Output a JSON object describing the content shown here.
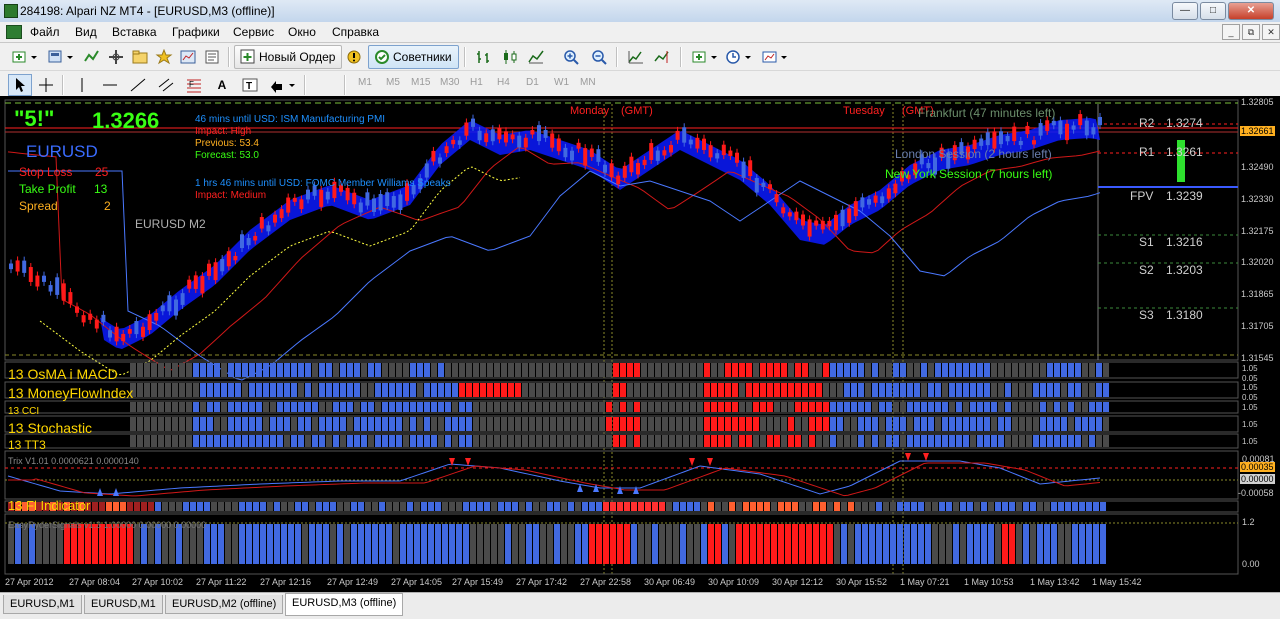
{
  "window": {
    "title": "284198: Alpari NZ MT4 - [EURUSD,M3 (offline)]"
  },
  "menu": [
    "Файл",
    "Вид",
    "Вставка",
    "Графики",
    "Сервис",
    "Окно",
    "Справка"
  ],
  "toolbar": {
    "new_order": "Новый Ордер",
    "experts": "Советники",
    "timeframes": [
      "M1",
      "M5",
      "M15",
      "M30",
      "H1",
      "H4",
      "D1",
      "W1",
      "MN"
    ]
  },
  "chart": {
    "big_left": "\"5!\"",
    "big_price": "1.3266",
    "symbol": "EURUSD",
    "symbol_period": "EURUSD M2",
    "stats": [
      {
        "label": "Stop Loss",
        "value": "25"
      },
      {
        "label": "Take Profit",
        "value": "13"
      },
      {
        "label": "Spread",
        "value": "2"
      }
    ],
    "news1": {
      "title": "46 mins until USD: ISM Manufacturing PMI",
      "impact": "Impact: High",
      "previous": "Previous: 53.4",
      "forecast": "Forecast: 53.0"
    },
    "news2": {
      "title": "1 hrs 46 mins until USD: FOMC Member Williams Speaks",
      "impact": "Impact: Medium"
    },
    "sessions": {
      "monday": "Monday",
      "gmt1": "(GMT)",
      "tuesday": "Tuesday",
      "gmt2": "(GMT)",
      "frankfurt": "Frankfurt (47 minutes left)",
      "london": "London Session (2 hours left)",
      "newyork": "New York Session (7 hours left)"
    },
    "pivots": [
      {
        "label": "R2",
        "value": "1.3274"
      },
      {
        "label": "R1",
        "value": "1.3261"
      },
      {
        "label": "FPV",
        "value": "1.3239"
      },
      {
        "label": "S1",
        "value": "1.3216"
      },
      {
        "label": "S2",
        "value": "1.3203"
      },
      {
        "label": "S3",
        "value": "1.3180"
      }
    ],
    "price_scale": [
      "1.32805",
      "1.32661",
      "1.32490",
      "1.32330",
      "1.32175",
      "1.32020",
      "1.31865",
      "1.31705",
      "1.31545"
    ],
    "current_price_tag": "1.32661",
    "indicator_labels": [
      "13 OsMA i MACD",
      "13 MoneyFlowIndex",
      "13 CCI",
      "13 Stochastic",
      "13 TT3"
    ],
    "indicator_scale_small": [
      "1.05",
      "0.05"
    ],
    "trix": {
      "label": "Trix V1.01 0.0000621 0.0000140",
      "scale": [
        "0.00081",
        "0.00035",
        "0.00000",
        "-0.00058"
      ]
    },
    "fl_label": "13 Fl Indicator",
    "easy": {
      "label": "EasyRyderSignals v1.3 1.00000 0.00000 0.00000",
      "scale": [
        "1.2",
        "0.00"
      ]
    },
    "time_axis": [
      "27 Apr 2012",
      "27 Apr 08:04",
      "27 Apr 10:02",
      "27 Apr 11:22",
      "27 Apr 12:16",
      "27 Apr 12:49",
      "27 Apr 14:05",
      "27 Apr 15:49",
      "27 Apr 17:42",
      "27 Apr 22:58",
      "30 Apr 06:49",
      "30 Apr 10:09",
      "30 Apr 12:12",
      "30 Apr 15:52",
      "1 May 07:21",
      "1 May 10:53",
      "1 May 13:42",
      "1 May 15:42"
    ]
  },
  "tabs": [
    "EURUSD,M1",
    "EURUSD,M1",
    "EURUSD,M2 (offline)",
    "EURUSD,M3 (offline)"
  ],
  "colors": {
    "bull": "#4169e1",
    "bear": "#ff1a1a",
    "cloud": "#0a1aff",
    "green_text": "#39ff14",
    "price_line": "#ff2020"
  }
}
